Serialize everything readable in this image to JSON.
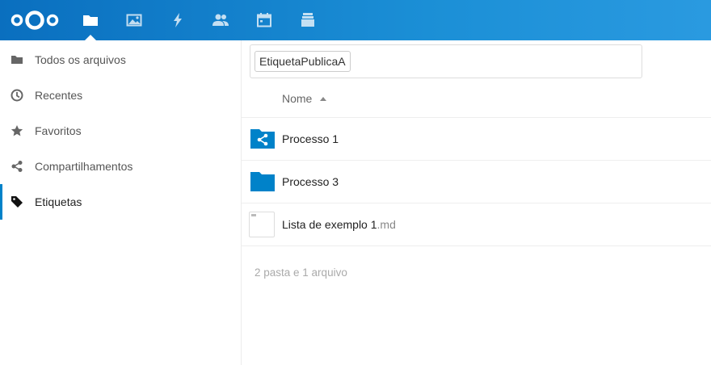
{
  "header": {
    "apps": [
      {
        "name": "files-app",
        "icon": "folder-icon",
        "active": true
      },
      {
        "name": "gallery-app",
        "icon": "image-icon",
        "active": false
      },
      {
        "name": "activity-app",
        "icon": "lightning-icon",
        "active": false
      },
      {
        "name": "contacts-app",
        "icon": "contacts-icon",
        "active": false
      },
      {
        "name": "calendar-app",
        "icon": "calendar-icon",
        "active": false
      },
      {
        "name": "deck-app",
        "icon": "stack-icon",
        "active": false
      }
    ],
    "colors": {
      "accent": "#0082c9",
      "header_start": "#0a6fbf",
      "header_end": "#2a9ae0"
    }
  },
  "sidebar": {
    "items": [
      {
        "label": "Todos os arquivos",
        "icon": "folder-icon"
      },
      {
        "label": "Recentes",
        "icon": "clock-icon"
      },
      {
        "label": "Favoritos",
        "icon": "star-icon"
      },
      {
        "label": "Compartilhamentos",
        "icon": "share-icon"
      },
      {
        "label": "Etiquetas",
        "icon": "tag-icon",
        "active": true
      }
    ]
  },
  "filter": {
    "tag": "EtiquetaPublicaA"
  },
  "table": {
    "column_name": "Nome",
    "sort": "ascending"
  },
  "files": [
    {
      "name": "Processo 1",
      "ext": "",
      "type": "shared-folder"
    },
    {
      "name": "Processo 3",
      "ext": "",
      "type": "folder"
    },
    {
      "name": "Lista de exemplo 1",
      "ext": ".md",
      "type": "file"
    }
  ],
  "summary": "2 pasta e 1 arquivo"
}
